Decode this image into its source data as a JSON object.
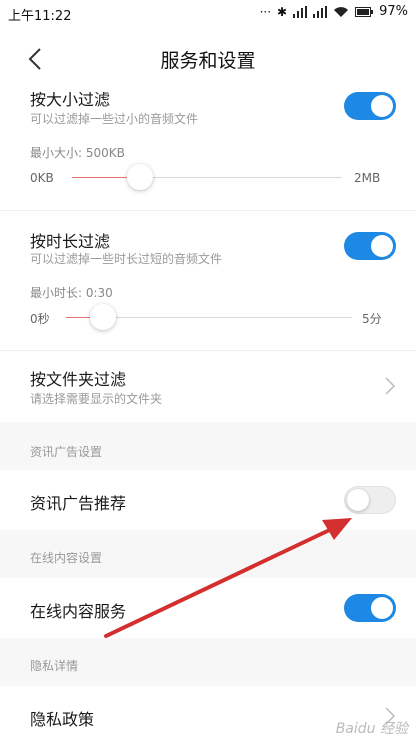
{
  "statusbar": {
    "time": "上午11:22",
    "battery": "97%"
  },
  "header": {
    "title": "服务和设置"
  },
  "size_filter": {
    "title": "按大小过滤",
    "subtitle": "可以过滤掉一些过小的音频文件",
    "min_label": "最小大小: 500KB",
    "range_min": "0KB",
    "range_max": "2MB",
    "value_fraction": 0.25,
    "enabled": true
  },
  "duration_filter": {
    "title": "按时长过滤",
    "subtitle": "可以过滤掉一些时长过短的音频文件",
    "min_label": "最小时长: 0:30",
    "range_min": "0秒",
    "range_max": "5分",
    "value_fraction": 0.13,
    "enabled": true
  },
  "folder_filter": {
    "title": "按文件夹过滤",
    "subtitle": "请选择需要显示的文件夹"
  },
  "ads_section": {
    "label": "资讯广告设置",
    "item": "资讯广告推荐",
    "enabled": false
  },
  "online_section": {
    "label": "在线内容设置",
    "item": "在线内容服务",
    "enabled": true
  },
  "privacy_section": {
    "label": "隐私详情",
    "item": "隐私政策"
  },
  "colors": {
    "accent": "#1e88e5",
    "slider_fill": "#e57373",
    "arrow": "#d32f2f"
  },
  "watermark": "Baidu 经验"
}
